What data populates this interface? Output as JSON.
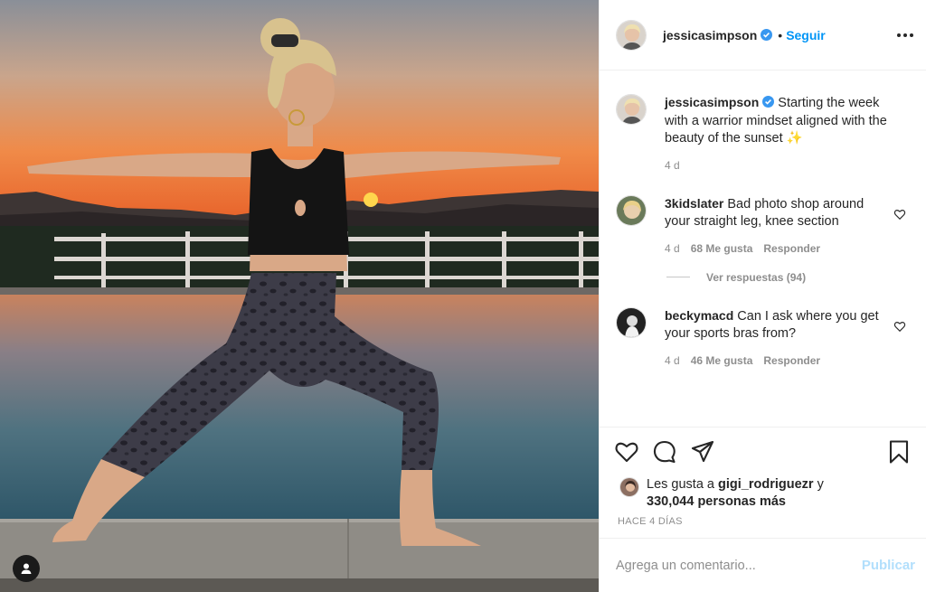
{
  "post": {
    "author": {
      "username": "jessicasimpson",
      "verified": true,
      "follow_label": "Seguir",
      "separator": "•"
    },
    "caption": {
      "text": "Starting the week with a warrior mindset aligned with the beauty of the sunset ✨",
      "time": "4 d"
    },
    "comments": [
      {
        "username": "3kidslater",
        "text": "Bad photo shop around your straight leg, knee section",
        "time": "4 d",
        "likes": "68 Me gusta",
        "reply_label": "Responder",
        "view_replies": "Ver respuestas (94)"
      },
      {
        "username": "beckymacd",
        "text": "Can I ask where you get your sports bras from?",
        "time": "4 d",
        "likes": "46 Me gusta",
        "reply_label": "Responder"
      }
    ],
    "likes_summary": {
      "prefix": "Les gusta a",
      "liker": "gigi_rodriguezr",
      "connector": "y",
      "count": "330,044 personas más"
    },
    "posted_ago": "HACE 4 DÍAS",
    "add_comment": {
      "placeholder": "Agrega un comentario...",
      "publish_label": "Publicar"
    }
  },
  "icons": {
    "like": "heart-icon",
    "comment": "comment-icon",
    "share": "paper-plane-icon",
    "save": "bookmark-icon",
    "more": "more-options-icon",
    "tags": "user-tag-icon"
  },
  "colors": {
    "accent": "#0095f6",
    "publish_disabled": "#b2dffc",
    "muted": "#8e8e8e"
  }
}
